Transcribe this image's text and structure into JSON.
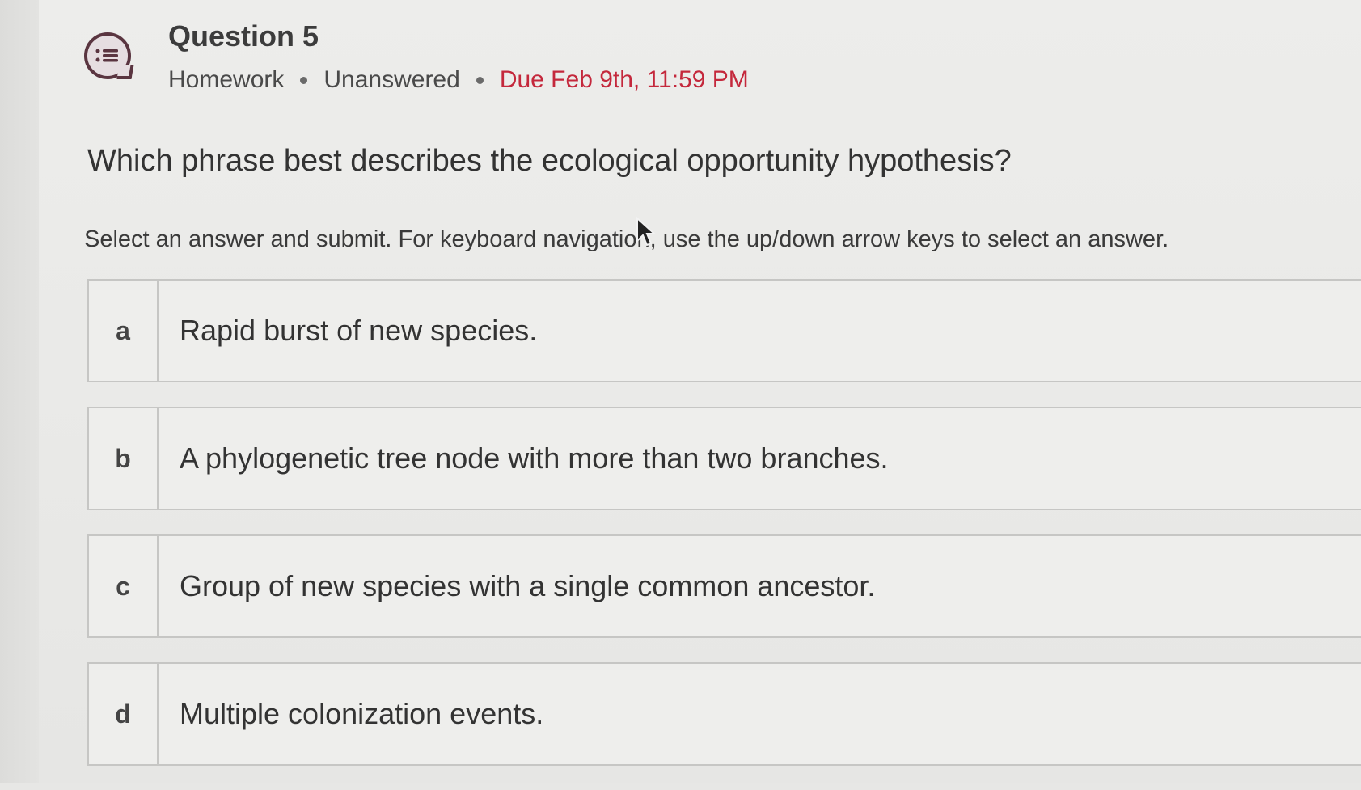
{
  "question": {
    "title": "Question 5",
    "category": "Homework",
    "status": "Unanswered",
    "due": "Due Feb 9th, 11:59 PM",
    "icon": "list-bubble-icon",
    "prompt": "Which phrase best describes the ecological opportunity hypothesis?",
    "instructions": "Select an answer and submit. For keyboard navigation, use the up/down arrow keys to select an answer."
  },
  "options": [
    {
      "letter": "a",
      "text": "Rapid burst of new species."
    },
    {
      "letter": "b",
      "text": "A phylogenetic tree node with more than two branches."
    },
    {
      "letter": "c",
      "text": "Group of new species with a single common ancestor."
    },
    {
      "letter": "d",
      "text": "Multiple colonization events."
    }
  ],
  "colors": {
    "accent": "#5a3540",
    "due": "#c4283c"
  }
}
